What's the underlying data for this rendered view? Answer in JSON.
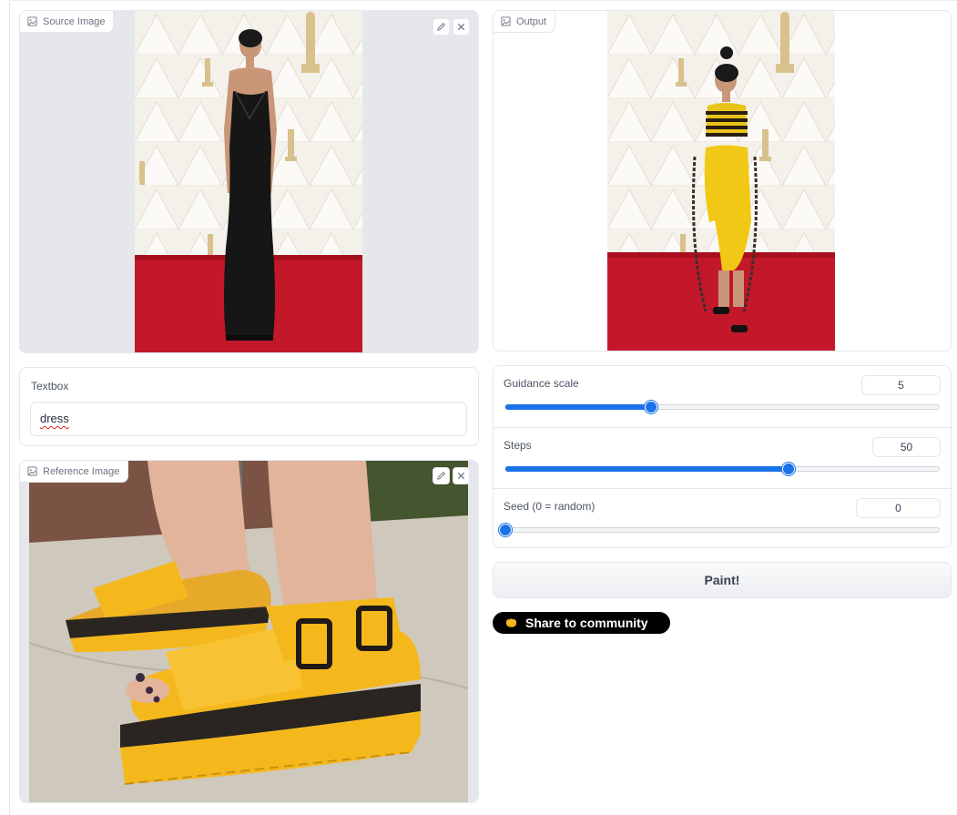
{
  "source_image": {
    "label": "Source Image"
  },
  "output_image": {
    "label": "Output"
  },
  "reference_image": {
    "label": "Reference Image"
  },
  "textbox": {
    "label": "Textbox",
    "value": "dress"
  },
  "sliders": [
    {
      "label": "Guidance scale",
      "value": "5",
      "fraction": 0.336
    },
    {
      "label": "Steps",
      "value": "50",
      "fraction": 0.653
    },
    {
      "label": "Seed (0 = random)",
      "value": "0",
      "fraction": 0.0
    }
  ],
  "paint_button": {
    "label": "Paint!"
  },
  "share_button": {
    "label": "Share to community"
  },
  "colors": {
    "accent": "#1a73e8",
    "carpet": "#c3182a",
    "shoe_yellow": "#f5b81c"
  },
  "icons": [
    "image-icon",
    "edit-icon",
    "close-icon",
    "hugging-face-icon"
  ]
}
